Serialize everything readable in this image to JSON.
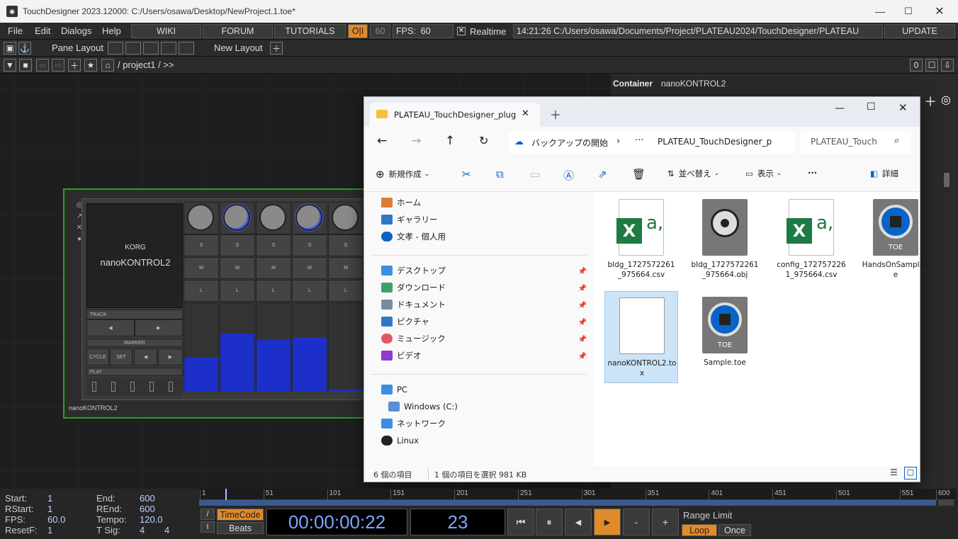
{
  "titlebar": {
    "title": "TouchDesigner 2023.12000: C:/Users/osawa/Desktop/NewProject.1.toe*"
  },
  "menu": {
    "items": [
      "File",
      "Edit",
      "Dialogs",
      "Help"
    ],
    "wiki": "WIKI",
    "forum": "FORUM",
    "tutorials": "TUTORIALS",
    "oi": "O|I",
    "fps_box": "60",
    "fps_label": "FPS:",
    "fps_value": "60",
    "realtime": "Realtime",
    "realtime_checked": true,
    "status_path": "14:21:26 C:/Users/osawa/Documents/Project/PLATEAU2024/TouchDesigner/PLATEAU",
    "update": "UPDATE"
  },
  "panebar": {
    "pane_layout": "Pane Layout",
    "new_layout": "New Layout"
  },
  "pathbar": {
    "path": "/ project1 / >>",
    "count": "0"
  },
  "rightpanel": {
    "type": "Container",
    "name": "nanoKONTROL2"
  },
  "nk": {
    "brand": "KORG",
    "model": "nanoKONTROL2",
    "node_name": "nanoKONTROL2",
    "labels": {
      "s": "S",
      "m": "M",
      "l": "L",
      "track": "TRACK",
      "marker": "MARKER",
      "cycle": "CYCLE",
      "set": "SET",
      "prev": "◀",
      "next": "▶",
      "play": "PLAY"
    },
    "fader_levels": [
      0.38,
      0.65,
      0.59,
      0.61,
      0.02
    ]
  },
  "explorer": {
    "tab_title": "PLATEAU_TouchDesigner_plug",
    "breadcrumb_backup": "バックアップの開始",
    "breadcrumb_path": "PLATEAU_TouchDesigner_p",
    "search_placeholder": "PLATEAU_Touch",
    "cmd": {
      "new": "新規作成",
      "sort": "並べ替え",
      "view": "表示",
      "more": "···",
      "details": "詳細"
    },
    "nav": {
      "home": "ホーム",
      "gallery": "ギャラリー",
      "onedrive": "文孝 - 個人用",
      "desktop": "デスクトップ",
      "downloads": "ダウンロード",
      "documents": "ドキュメント",
      "pictures": "ピクチャ",
      "music": "ミュージック",
      "videos": "ビデオ",
      "pc": "PC",
      "drive_c": "Windows (C:)",
      "network": "ネットワーク",
      "linux": "Linux"
    },
    "files": [
      {
        "name": "bldg_1727572261_975664.csv",
        "icon": "excel-icon"
      },
      {
        "name": "bldg_1727572261_975664.obj",
        "icon": "obj-icon"
      },
      {
        "name": "config_1727572261_975664.csv",
        "icon": "excel-icon"
      },
      {
        "name": "HandsOnSampl.toe",
        "icon": "toe-icon"
      },
      {
        "name": "nanoKONTROL2.tox",
        "icon": "blank-file-icon",
        "selected": true
      },
      {
        "name": "Sample.toe",
        "icon": "toe-icon"
      }
    ],
    "status": {
      "count": "6 個の項目",
      "selected": "1 個の項目を選択  981 KB"
    }
  },
  "bottom": {
    "start_label": "Start:",
    "start": "1",
    "end_label": "End:",
    "end": "600",
    "rstart_label": "RStart:",
    "rstart": "1",
    "rend_label": "REnd:",
    "rend": "600",
    "fps_label": "FPS:",
    "fps": "60.0",
    "tempo_label": "Tempo:",
    "tempo": "120.0",
    "resetf_label": "ResetF:",
    "resetf": "1",
    "tsig_label": "T Sig:",
    "tsig_a": "4",
    "tsig_b": "4",
    "ruler": [
      "1",
      "51",
      "101",
      "151",
      "201",
      "251",
      "301",
      "351",
      "401",
      "451",
      "501",
      "551",
      "600"
    ],
    "timecode": "TimeCode",
    "beats": "Beats",
    "time": "00:00:00:22",
    "frame": "23",
    "range_limit": "Range Limit",
    "loop": "Loop",
    "once": "Once"
  },
  "colors": {
    "accent_orange": "#e08a2a",
    "td_green": "#1fa51f",
    "fader_blue": "#1c2fc9",
    "time_blue": "#7da4ff"
  }
}
